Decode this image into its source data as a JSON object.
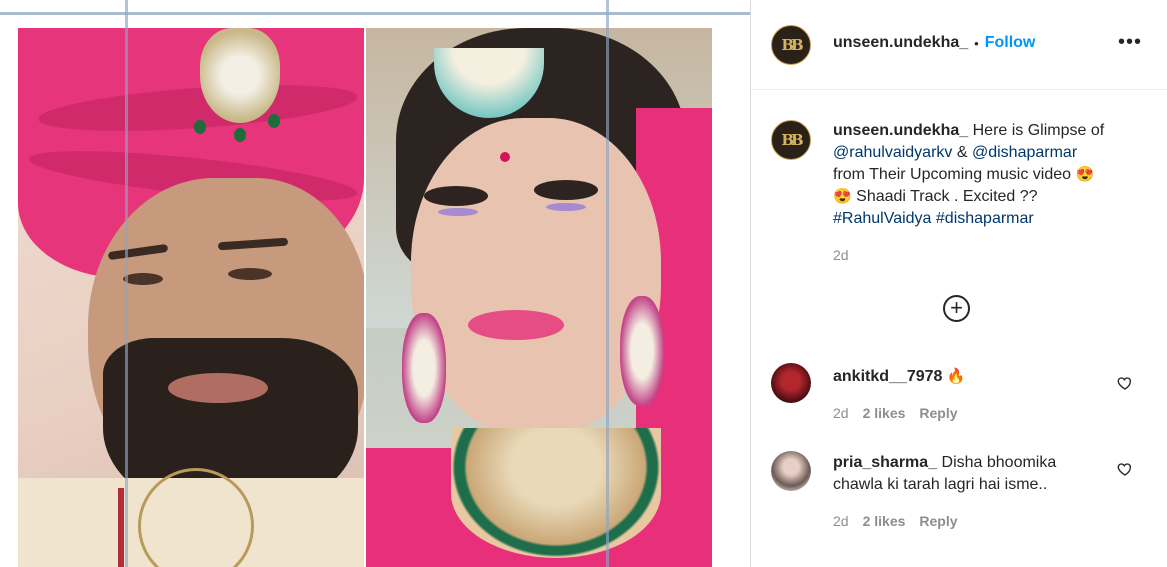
{
  "post": {
    "username": "unseen.undekha_",
    "separator": "•",
    "follow_label": "Follow",
    "avatar_text": "BB",
    "more_icon": "more-horizontal-icon",
    "caption": {
      "lead": "Here is Glimpse of",
      "mention1": "@rahulvaidyarkv",
      "amp": "&",
      "mention2": "@dishaparmar",
      "line2": "from Their Upcoming music video",
      "line3": "Shaadi Track . Excited ??",
      "hashtag1": "#RahulVaidya",
      "hashtag2": "#dishaparmar",
      "emoji1": "😍",
      "emoji2": "😍"
    },
    "time": "2d",
    "load_more_icon": "plus-circle-icon",
    "load_more_glyph": "+"
  },
  "comments": [
    {
      "username": "ankitkd__7978",
      "text": "",
      "emoji": "🔥",
      "time": "2d",
      "likes": "2 likes",
      "reply": "Reply"
    },
    {
      "username": "pria_sharma_",
      "text": "Disha bhoomika chawla ki tarah lagri hai isme..",
      "emoji": "",
      "time": "2d",
      "likes": "2 likes",
      "reply": "Reply"
    }
  ],
  "colors": {
    "accent": "#0095f6",
    "link": "#00376b",
    "muted": "#8e8e8e",
    "turban": "#e6357a",
    "dupatta": "#e8307a"
  }
}
